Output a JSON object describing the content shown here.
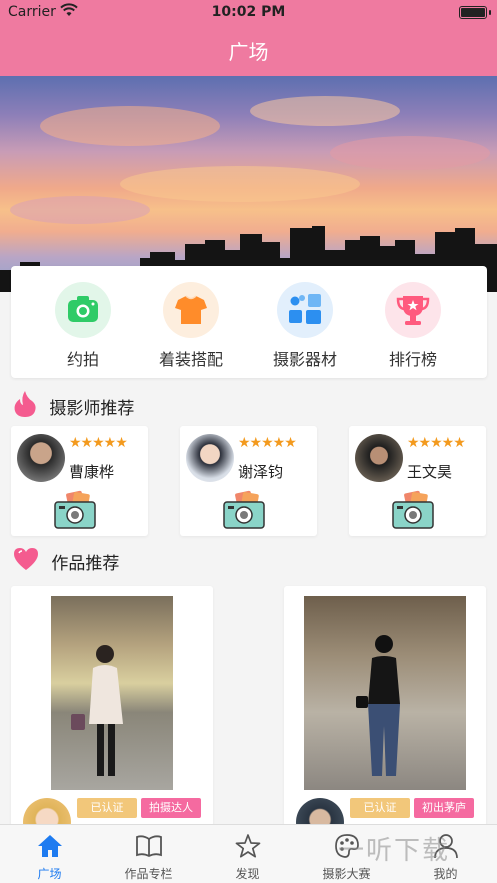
{
  "status": {
    "carrier": "Carrier",
    "time": "10:02 PM"
  },
  "nav": {
    "title": "广场"
  },
  "categories": [
    {
      "label": "约拍",
      "icon": "camera-icon",
      "color": "#2fcb67"
    },
    {
      "label": "着装搭配",
      "icon": "tshirt-icon",
      "color": "#ff8c2a"
    },
    {
      "label": "摄影器材",
      "icon": "equipment-grid-icon",
      "color": "#2c8ff0"
    },
    {
      "label": "排行榜",
      "icon": "trophy-icon",
      "color": "#ff5a7e"
    }
  ],
  "sections": {
    "photographers": "摄影师推荐",
    "works": "作品推荐"
  },
  "photographers": [
    {
      "name": "曹康桦",
      "stars": "★★★★★",
      "rating": 5
    },
    {
      "name": "谢泽钧",
      "stars": "★★★★★",
      "rating": 5
    },
    {
      "name": "王文昊",
      "stars": "★★★★★",
      "rating": 5
    }
  ],
  "works": [
    {
      "tags": [
        "已认证",
        "拍摄达人"
      ]
    },
    {
      "tags": [
        "已认证",
        "初出茅庐"
      ]
    }
  ],
  "tabs": [
    {
      "label": "广场",
      "icon": "home-icon",
      "active": true
    },
    {
      "label": "作品专栏",
      "icon": "book-icon",
      "active": false
    },
    {
      "label": "发现",
      "icon": "star-icon",
      "active": false
    },
    {
      "label": "摄影大赛",
      "icon": "palette-icon",
      "active": false
    },
    {
      "label": "我的",
      "icon": "user-icon",
      "active": false
    }
  ],
  "watermark": "一听下载",
  "colors": {
    "accent": "#ef7aa0",
    "tab_active": "#1e7bf0",
    "star": "#f39a1e",
    "tag_verified": "#f2c77a",
    "tag_level": "#f56aa0"
  }
}
